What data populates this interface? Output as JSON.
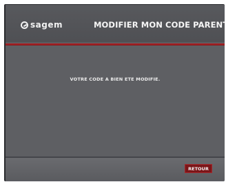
{
  "header": {
    "logo_text": "sagem",
    "title": "MODIFIER MON CODE PARENT"
  },
  "main": {
    "message": "VOTRE CODE A BIEN ETE MODIFIE."
  },
  "footer": {
    "back_label": "RETOUR"
  },
  "colors": {
    "accent_red": "#7b1518",
    "background_grey": "#5e5f63"
  },
  "icons": {
    "logo": "sagem-logo-icon"
  }
}
